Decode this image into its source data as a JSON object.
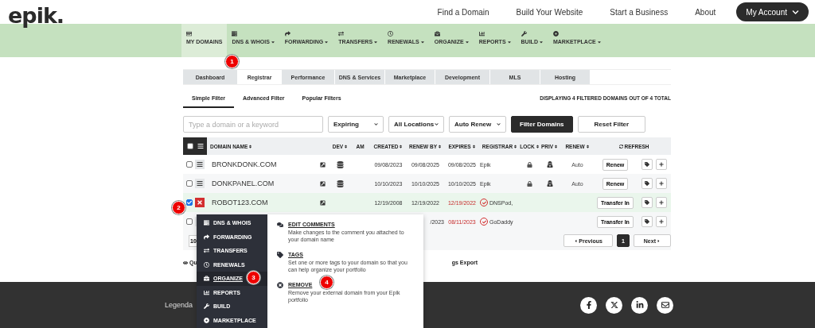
{
  "header": {
    "logo": "epik.",
    "links": [
      "Find a Domain",
      "Build Your Website",
      "Start a Business",
      "About"
    ],
    "account_button": "My Account"
  },
  "main_nav": [
    {
      "label": "MY DOMAINS",
      "selected": true
    },
    {
      "label": "DNS & WHOIS",
      "selected": false
    },
    {
      "label": "FORWARDING",
      "selected": false
    },
    {
      "label": "TRANSFERS",
      "selected": false
    },
    {
      "label": "RENEWALS",
      "selected": false
    },
    {
      "label": "ORGANIZE",
      "selected": false
    },
    {
      "label": "REPORTS",
      "selected": false
    },
    {
      "label": "BUILD",
      "selected": false
    },
    {
      "label": "MARKETPLACE",
      "selected": false
    }
  ],
  "sub_tabs": [
    {
      "label": "Dashboard",
      "selected": false
    },
    {
      "label": "Registrar",
      "selected": true
    },
    {
      "label": "Performance",
      "selected": false
    },
    {
      "label": "DNS & Services",
      "selected": false
    },
    {
      "label": "Marketplace",
      "selected": false
    },
    {
      "label": "Development",
      "selected": false
    },
    {
      "label": "MLS",
      "selected": false
    },
    {
      "label": "Hosting",
      "selected": false
    }
  ],
  "filter_tabs": [
    {
      "label": "Simple Filter",
      "selected": true
    },
    {
      "label": "Advanced Filter",
      "selected": false
    },
    {
      "label": "Popular Filters",
      "selected": false
    }
  ],
  "result_count": "DISPLAYING 4 FILTERED DOMAINS OUT OF 4 TOTAL",
  "filters": {
    "search_placeholder": "Type a domain or a keyword",
    "dropdowns": [
      "Expiring",
      "All Locations",
      "Auto Renew"
    ],
    "filter_button": "Filter Domains",
    "reset_button": "Reset Filter"
  },
  "table": {
    "select_all_checked": false,
    "columns": [
      "DOMAIN NAME",
      "DEV",
      "AM",
      "CREATED",
      "RENEW BY",
      "EXPIRES",
      "REGISTRAR",
      "LOCK",
      "PRIV",
      "RENEW",
      "REFRESH"
    ],
    "rows": [
      {
        "kind": "managed",
        "checked": false,
        "menu_open": false,
        "domain": "BRONKDONK.COM",
        "created": "09/08/2023",
        "renew_by": "09/08/2025",
        "expires": "09/08/2025",
        "expired": false,
        "registrar": "Epik",
        "locked": true,
        "privacy": true,
        "renew": "Auto",
        "action": "Renew"
      },
      {
        "kind": "managed",
        "checked": false,
        "menu_open": false,
        "domain": "DONKPANEL.COM",
        "created": "10/10/2023",
        "renew_by": "10/10/2025",
        "expires": "10/10/2025",
        "expired": false,
        "registrar": "Epik",
        "locked": true,
        "privacy": true,
        "renew": "Auto",
        "action": "Renew"
      },
      {
        "kind": "external",
        "checked": true,
        "menu_open": true,
        "domain": "ROBOT123.COM",
        "created": "12/19/2008",
        "renew_by": "12/19/2022",
        "expires": "12/19/2022",
        "expired": true,
        "registrar": "DNSPod,",
        "action": "Transfer In"
      },
      {
        "kind": "external",
        "checked": false,
        "menu_open": false,
        "renew_by": "/2023",
        "expires": "08/11/2023",
        "expired": true,
        "registrar": "GoDaddy",
        "action": "Transfer In"
      }
    ]
  },
  "pagination": {
    "page_size": "10",
    "previous": "Previous",
    "pages": [
      {
        "label": "1",
        "selected": true
      }
    ],
    "next": "Next"
  },
  "bottom_links": {
    "left": "Qu",
    "right": "gs Export"
  },
  "context_menu": {
    "categories": [
      {
        "label": "DNS & WHOIS",
        "selected": false
      },
      {
        "label": "FORWARDING",
        "selected": false
      },
      {
        "label": "TRANSFERS",
        "selected": false
      },
      {
        "label": "RENEWALS",
        "selected": false
      },
      {
        "label": "ORGANIZE",
        "selected": true
      },
      {
        "label": "REPORTS",
        "selected": false
      },
      {
        "label": "BUILD",
        "selected": false
      },
      {
        "label": "MARKETPLACE",
        "selected": false
      }
    ],
    "options": [
      {
        "title": "EDIT COMMENTS",
        "description": "Make changes to the comment you attached to your domain name"
      },
      {
        "title": "TAGS",
        "description": "Set one or more tags to your domain so that you can help organize your portfolio"
      },
      {
        "title": "REMOVE",
        "description": "Remove your external domain from your Epik portfolio"
      }
    ]
  },
  "footer": {
    "text": "Legenda"
  },
  "callouts": [
    "1",
    "2",
    "3",
    "4"
  ]
}
